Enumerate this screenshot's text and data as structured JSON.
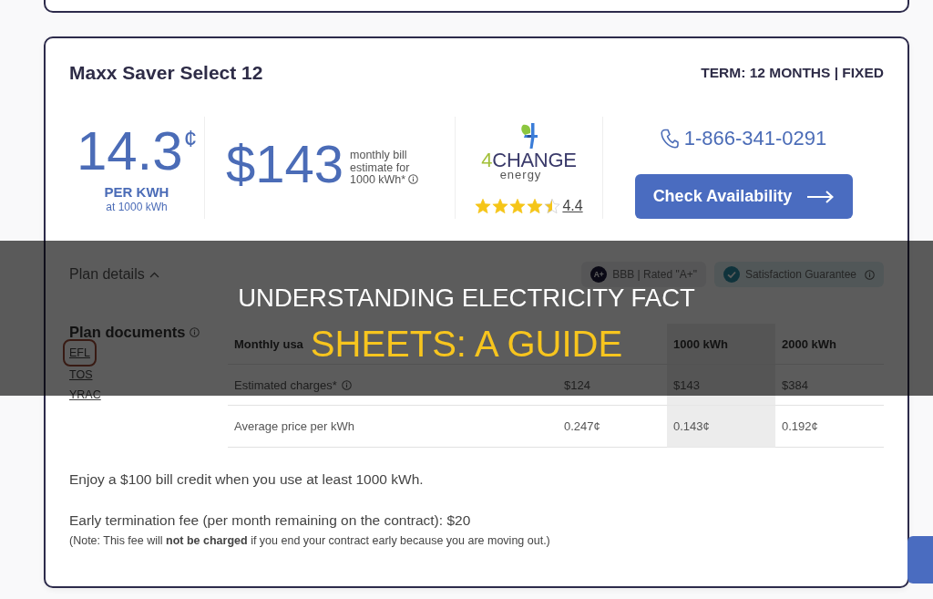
{
  "plan_card": {
    "name": "Maxx Saver Select 12",
    "term": "TERM: 12 MONTHS | FIXED",
    "rate": {
      "value": "14.3",
      "unit": "¢",
      "label": "PER KWH",
      "note": "at 1000 kWh"
    },
    "bill": {
      "amount": "$143",
      "caption": "monthly bill estimate for 1000 kWh*"
    },
    "provider": {
      "wordmark_lead": "4",
      "wordmark": "CHANGE",
      "tagline": "energy",
      "stars": 4.5,
      "rating": "4.4"
    },
    "contact": {
      "phone": "1-866-341-0291",
      "button": "Check Availability"
    },
    "details_toggle": {
      "label": "Plan details",
      "expanded": true
    },
    "badges": [
      {
        "kind": "bbb",
        "grade": "A+",
        "label": "BBB | Rated \"A+\""
      },
      {
        "kind": "guarantee",
        "label": "Satisfaction Guarantee"
      }
    ],
    "documents": {
      "title": "Plan documents",
      "links": [
        {
          "label": "EFL",
          "circled": true
        },
        {
          "label": "TOS",
          "circled": false
        },
        {
          "label": "YRAC",
          "circled": false
        }
      ]
    },
    "usage_table": {
      "label_heading": "Monthly usa",
      "columns": [
        {
          "selected": false
        },
        {
          "label": "1000 kWh",
          "selected": true
        },
        {
          "label": "2000 kWh",
          "selected": false
        }
      ],
      "rows": [
        {
          "label": "Estimated charges*",
          "info": true,
          "cells": [
            "$124",
            "$143",
            "$384"
          ]
        },
        {
          "label": "Average price per kWh",
          "info": false,
          "cells": [
            "0.247¢",
            "0.143¢",
            "0.192¢"
          ]
        }
      ]
    },
    "notes": [
      {
        "kind": "paragraph",
        "text": "Enjoy a $100 bill credit when you use at least 1000 kWh."
      },
      {
        "kind": "paragraph",
        "text": "Early termination fee (per month remaining on the contract): $20"
      },
      {
        "kind": "footnote",
        "text": "(Note: This fee will **not be charged** if you end your contract early because you are moving out.)"
      }
    ]
  },
  "banner": {
    "lines": [
      {
        "text": "UNDERSTANDING ELECTRICITY FACT",
        "accent": false
      },
      {
        "text": "SHEETS: A GUIDE",
        "accent": true
      }
    ]
  }
}
